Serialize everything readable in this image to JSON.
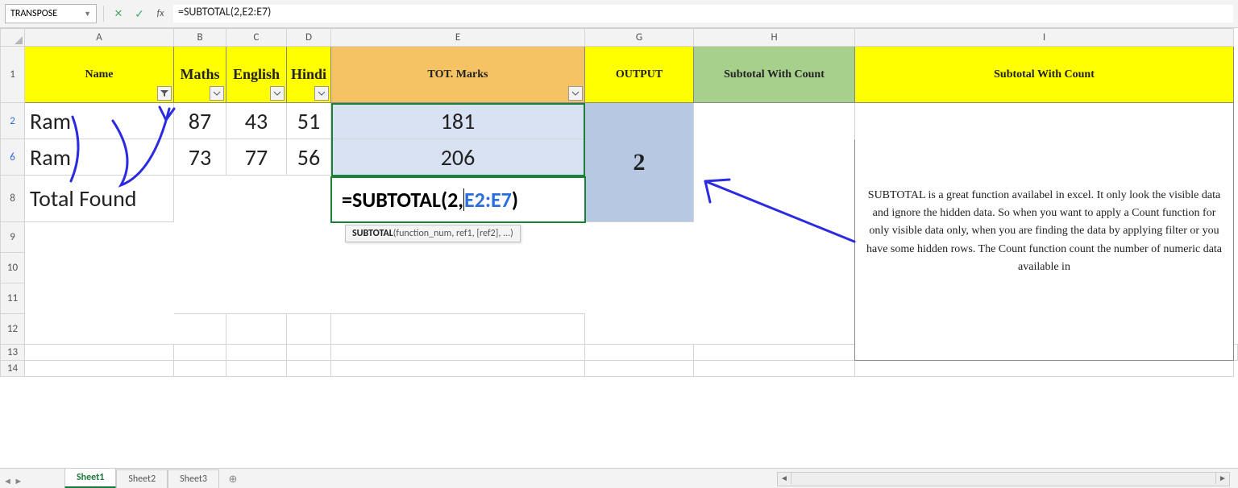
{
  "formula_bar": {
    "name_box": "TRANSPOSE",
    "cancel_glyph": "✕",
    "confirm_glyph": "✓",
    "fx_label": "fx",
    "formula": "=SUBTOTAL(2,E2:E7)"
  },
  "columns": [
    "A",
    "B",
    "C",
    "D",
    "E",
    "G",
    "H",
    "I"
  ],
  "row_headers": [
    "1",
    "2",
    "6",
    "8",
    "9",
    "10",
    "11",
    "12",
    "13",
    "14"
  ],
  "header": {
    "A": "Name",
    "B": "Maths",
    "C": "English",
    "D": "Hindi",
    "E": "TOT. Marks",
    "G": "OUTPUT",
    "H": "Subtotal With Count",
    "I": "Subtotal With Count"
  },
  "rows": [
    {
      "rn": "2",
      "name": "Ram",
      "maths": "87",
      "english": "43",
      "hindi": "51",
      "tot": "181"
    },
    {
      "rn": "6",
      "name": "Ram",
      "maths": "73",
      "english": "77",
      "hindi": "56",
      "tot": "206"
    }
  ],
  "total_row": {
    "rn": "8",
    "label": "Total Found",
    "formula_prefix": "=SUBTOTAL(2,",
    "formula_ref": "E2:E7",
    "formula_suffix": ")"
  },
  "output_value": "2",
  "tooltip": {
    "bold": "SUBTOTAL",
    "rest": "(function_num, ref1, [ref2], ...)"
  },
  "description": "SUBTOTAL is a great function availabel in excel. It only look the visible data and ignore the hidden data. So when you want to apply a Count function for only visible data only, when you are finding the data by applying filter or you have some hidden rows. The Count function count the number of numeric data available in",
  "tabs": [
    "Sheet1",
    "Sheet2",
    "Sheet3"
  ],
  "new_sheet_glyph": "⊕"
}
